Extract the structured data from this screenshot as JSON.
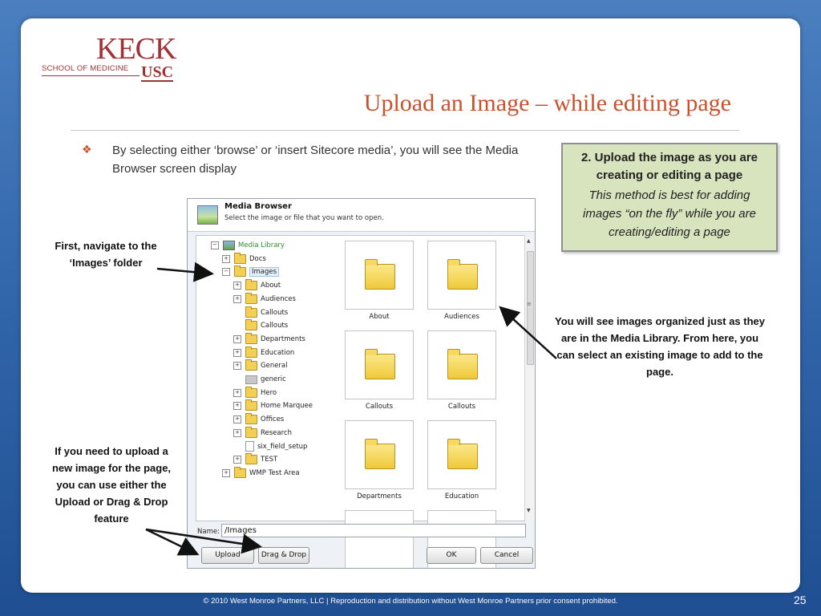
{
  "logo": {
    "name": "KECK",
    "school": "SCHOOL OF MEDICINE",
    "usc": "USC"
  },
  "title": "Upload an Image – while editing page",
  "bullet": {
    "glyph": "❖",
    "text": "By selecting either ‘browse’ or ‘insert Sitecore media’, you will see the Media Browser screen display"
  },
  "callout": {
    "title": "2. Upload the image as you are creating or editing a page",
    "body": "This method is best for adding images “on the fly” while you are creating/editing a page"
  },
  "notes": {
    "navigate": "First, navigate to the ‘Images’ folder",
    "organized": "You will see images organized just as they are in the Media Library. From here, you can select an existing image to add to the page.",
    "upload": "If you need to upload a new image for the page, you can use either the Upload or Drag & Drop feature"
  },
  "media_browser": {
    "title": "Media Browser",
    "subtitle": "Select the image or file that you want to open.",
    "tree": [
      {
        "label": "Media Library",
        "exp": "⊟",
        "icon": "library"
      },
      {
        "label": "Docs",
        "exp": "⊞",
        "icon": "folder"
      },
      {
        "label": "Images",
        "exp": "⊟",
        "icon": "folder"
      },
      {
        "label": "About",
        "exp": "⊞",
        "icon": "folder"
      },
      {
        "label": "Audiences",
        "exp": "⊞",
        "icon": "folder"
      },
      {
        "label": "Callouts",
        "exp": "",
        "icon": "folder"
      },
      {
        "label": "Callouts",
        "exp": "",
        "icon": "folder"
      },
      {
        "label": "Departments",
        "exp": "⊞",
        "icon": "folder"
      },
      {
        "label": "Education",
        "exp": "⊞",
        "icon": "folder"
      },
      {
        "label": "General",
        "exp": "⊞",
        "icon": "folder"
      },
      {
        "label": "generic",
        "exp": "",
        "icon": "image"
      },
      {
        "label": "Hero",
        "exp": "⊞",
        "icon": "folder"
      },
      {
        "label": "Home Marquee",
        "exp": "⊞",
        "icon": "folder"
      },
      {
        "label": "Offices",
        "exp": "⊞",
        "icon": "folder"
      },
      {
        "label": "Research",
        "exp": "⊞",
        "icon": "folder"
      },
      {
        "label": "six_field_setup",
        "exp": "",
        "icon": "document"
      },
      {
        "label": "TEST",
        "exp": "⊞",
        "icon": "folder"
      },
      {
        "label": "WMP Test Area",
        "exp": "⊞",
        "icon": "folder"
      }
    ],
    "tiles": [
      "About",
      "Audiences",
      "Callouts",
      "Callouts",
      "Departments",
      "Education"
    ],
    "name_label": "Name:",
    "name_value": "/Images",
    "buttons": {
      "upload": "Upload",
      "drag_drop": "Drag & Drop",
      "ok": "OK",
      "cancel": "Cancel"
    }
  },
  "footer": "© 2010 West Monroe Partners, LLC  |  Reproduction and distribution without West Monroe Partners prior consent prohibited.",
  "page_number": "25",
  "colors": {
    "accent": "#c9522b",
    "logo": "#a03236",
    "callout_bg": "#d7e4bd",
    "background": "#2f63a8"
  }
}
